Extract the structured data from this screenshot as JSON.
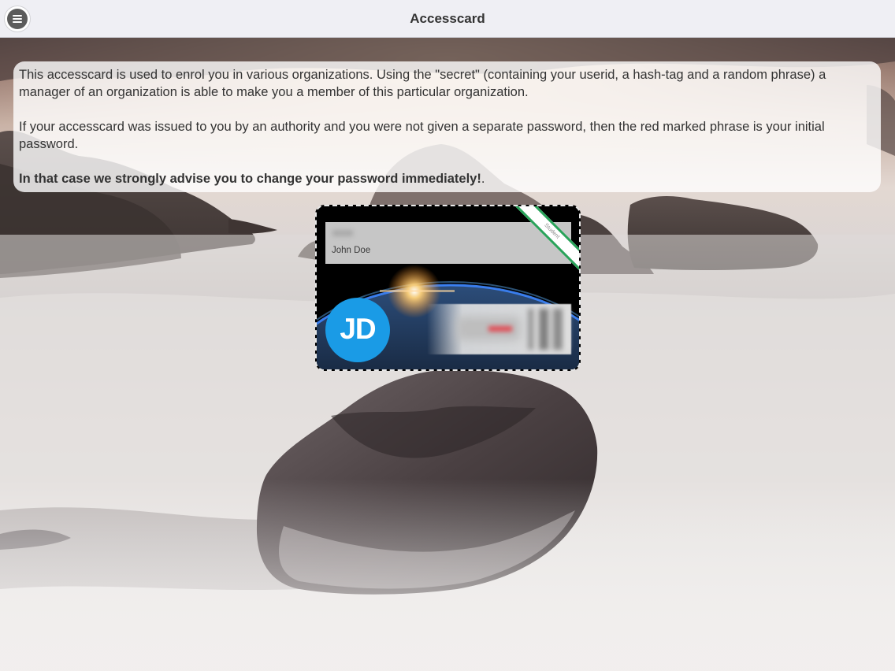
{
  "topbar": {
    "title": "Accesscard",
    "menu_icon": "hamburger-menu-icon"
  },
  "info": {
    "paragraph1": "This accesscard is used to enrol you in various organizations. Using the \"secret\" (containing your userid, a hash-tag and a random phrase) a manager of an organization is able to make you a member of this particular organization.",
    "paragraph2": "If your accesscard was issued to you by an authority and you were not given a separate password, then the red marked phrase is your initial password.",
    "warning": "In that case we strongly advise you to change your password immediately!",
    "warning_tail": "."
  },
  "card": {
    "name": "John Doe",
    "initials": "JD",
    "ribbon_label": "Student",
    "avatar_color": "#1a9be6",
    "ribbon_color": "#2aa35a",
    "secret_highlight_color": "#e24a52"
  },
  "colors": {
    "topbar_bg": "#efeff4",
    "title_text": "#333333"
  }
}
